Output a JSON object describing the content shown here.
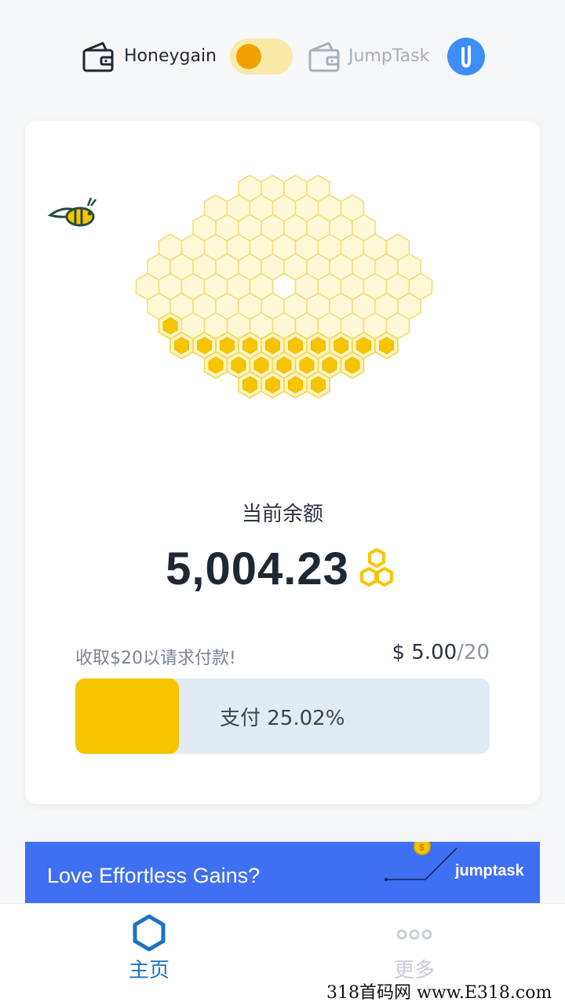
{
  "switcher": {
    "left_label": "Honeygain",
    "right_label": "JumpTask",
    "active": "Honeygain"
  },
  "card": {
    "balance_label": "当前余额",
    "balance_value": "5,004.23",
    "collect_text": "收取$20以请求付款!",
    "collect_current": "$ 5.00",
    "collect_goal": "/20",
    "progress_text": "支付 25.02%",
    "progress_fraction": 0.2502
  },
  "banner": {
    "title": "Love Effortless Gains?",
    "brand": "jumptask"
  },
  "nav": {
    "home_label": "主页",
    "more_label": "更多"
  },
  "watermark": "318首码网 www.E318.com",
  "colors": {
    "honey": "#f7c500",
    "honey_light": "#fff8d6",
    "accent_blue": "#1a72c4",
    "banner_blue": "#3f6ff2"
  }
}
